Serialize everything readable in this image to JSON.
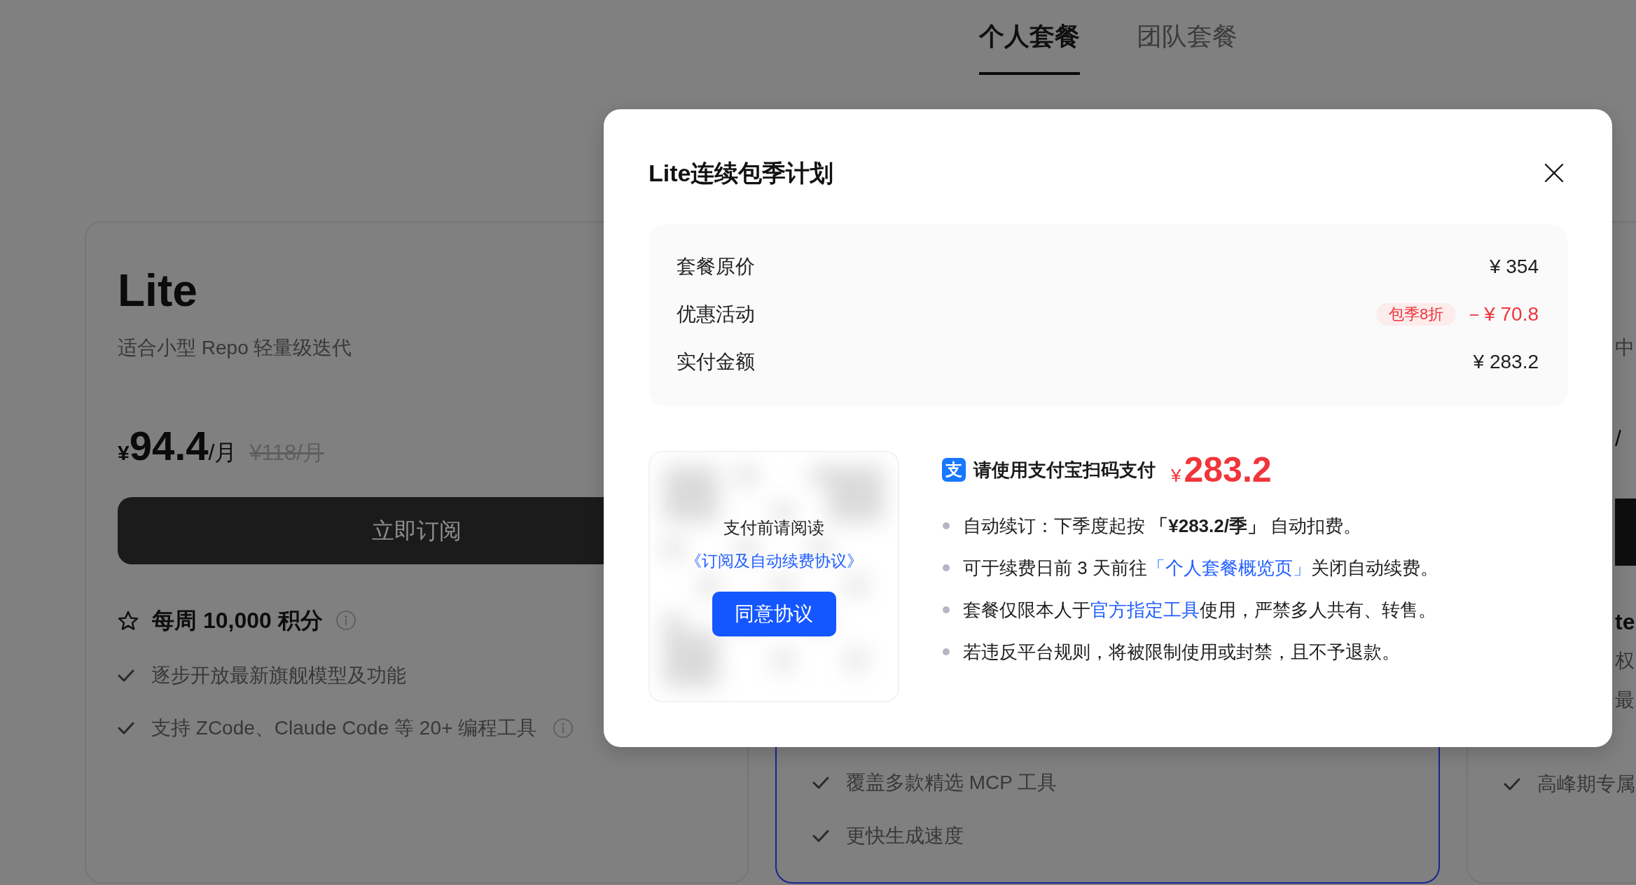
{
  "tabs": [
    {
      "label": "个人套餐",
      "selected": true
    },
    {
      "label": "团队套餐",
      "selected": false
    }
  ],
  "plans": [
    {
      "kind": "full",
      "highlighted": false,
      "name": "Lite",
      "subtitle": "适合小型 Repo 轻量级迭代",
      "price": {
        "currency": "¥",
        "amount": "94.4",
        "unit": "/月"
      },
      "original_price": "¥118/月",
      "button": "立即订阅",
      "credits": {
        "text": "每周 10,000 积分",
        "info": true
      },
      "features": [
        {
          "text": "逐步开放最新旗舰模型及功能",
          "info": false
        },
        {
          "text": "支持 ZCode、Claude Code 等 20+ 编程工具",
          "info": true
        }
      ]
    },
    {
      "kind": "covered",
      "highlighted": true,
      "features": [
        {
          "text": "覆盖多款精选 MCP 工具",
          "info": false
        },
        {
          "text": "更快生成速度",
          "info": false
        }
      ]
    },
    {
      "kind": "edge",
      "highlighted": false,
      "fragments": [
        {
          "kind": "subtitle",
          "text": "中"
        },
        {
          "kind": "price",
          "text": "/"
        },
        {
          "kind": "button"
        },
        {
          "kind": "credits",
          "text": "te"
        },
        {
          "kind": "feature",
          "text": "权"
        },
        {
          "kind": "feature",
          "text": "最"
        }
      ],
      "features": [
        {
          "text": "高峰期专属",
          "info": false
        }
      ]
    }
  ],
  "modal": {
    "title": "Lite连续包季计划",
    "summary": [
      {
        "kind": "plain",
        "label": "套餐原价",
        "value": "¥ 354"
      },
      {
        "kind": "discount",
        "label": "优惠活动",
        "badge": "包季8折",
        "value": "－¥ 70.8"
      },
      {
        "kind": "plain",
        "label": "实付金额",
        "value": "¥ 283.2"
      }
    ],
    "qr": {
      "notice": "支付前请阅读",
      "agreement": "《订阅及自动续费协议》",
      "button": "同意协议"
    },
    "payment": {
      "logo_glyph": "支",
      "heading": "请使用支付宝扫码支付",
      "currency": "¥",
      "amount": "283.2"
    },
    "terms": [
      {
        "segments": [
          {
            "kind": "text",
            "text": "自动续订：下季度起按 **「¥283.2/季」** 自动扣费。"
          }
        ]
      },
      {
        "segments": [
          {
            "kind": "text",
            "text": "可于续费日前 3 天前往"
          },
          {
            "kind": "link",
            "text": "「个人套餐概览页」"
          },
          {
            "kind": "text",
            "text": "关闭自动续费。"
          }
        ]
      },
      {
        "segments": [
          {
            "kind": "text",
            "text": "套餐仅限本人于"
          },
          {
            "kind": "link",
            "text": "官方指定工具"
          },
          {
            "kind": "text",
            "text": "使用，严禁多人共有、转售。"
          }
        ]
      },
      {
        "segments": [
          {
            "kind": "text",
            "text": "若违反平台规则，将被限制使用或封禁，且不予退款。"
          }
        ]
      }
    ]
  }
}
